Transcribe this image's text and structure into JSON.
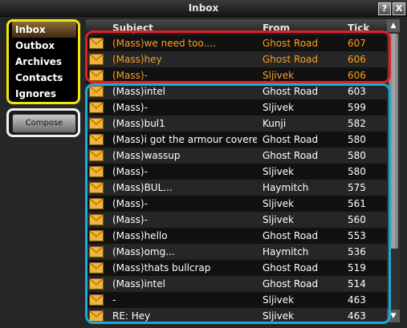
{
  "window": {
    "title": "Inbox",
    "help_label": "?",
    "close_label": "X"
  },
  "nav": {
    "items": [
      {
        "label": "Inbox",
        "selected": true
      },
      {
        "label": "Outbox",
        "selected": false
      },
      {
        "label": "Archives",
        "selected": false
      },
      {
        "label": "Contacts",
        "selected": false
      },
      {
        "label": "Ignores",
        "selected": false
      }
    ]
  },
  "compose": {
    "label": "Compose"
  },
  "table": {
    "columns": {
      "subject": "Subject",
      "from": "From",
      "tick": "Tick"
    },
    "rows": [
      {
        "subject": "(Mass)we need too....",
        "from": "Ghost Road",
        "tick": "607",
        "unread": true
      },
      {
        "subject": "(Mass)hey",
        "from": "Ghost Road",
        "tick": "606",
        "unread": true
      },
      {
        "subject": "(Mass)-",
        "from": "Sljivek",
        "tick": "606",
        "unread": true
      },
      {
        "subject": "(Mass)intel",
        "from": "Ghost Road",
        "tick": "603",
        "unread": false
      },
      {
        "subject": "(Mass)-",
        "from": "Sljivek",
        "tick": "599",
        "unread": false
      },
      {
        "subject": "(Mass)bul1",
        "from": "Kunji",
        "tick": "582",
        "unread": false
      },
      {
        "subject": "(Mass)i got the armour covered",
        "from": "Ghost Road",
        "tick": "580",
        "unread": false
      },
      {
        "subject": "(Mass)wassup",
        "from": "Ghost Road",
        "tick": "580",
        "unread": false
      },
      {
        "subject": "(Mass)-",
        "from": "Sljivek",
        "tick": "580",
        "unread": false
      },
      {
        "subject": "(Mass)BUL...",
        "from": "Haymitch",
        "tick": "575",
        "unread": false
      },
      {
        "subject": "(Mass)-",
        "from": "Sljivek",
        "tick": "561",
        "unread": false
      },
      {
        "subject": "(Mass)-",
        "from": "Sljivek",
        "tick": "560",
        "unread": false
      },
      {
        "subject": "(Mass)hello",
        "from": "Ghost Road",
        "tick": "553",
        "unread": false
      },
      {
        "subject": "(Mass)omg...",
        "from": "Haymitch",
        "tick": "536",
        "unread": false
      },
      {
        "subject": "(Mass)thats bullcrap",
        "from": "Ghost Road",
        "tick": "519",
        "unread": false
      },
      {
        "subject": "(Mass)intel",
        "from": "Ghost Road",
        "tick": "514",
        "unread": false
      },
      {
        "subject": "-",
        "from": "Sljivek",
        "tick": "463",
        "unread": false
      },
      {
        "subject": "RE: Hey",
        "from": "Sljivek",
        "tick": "463",
        "unread": false
      }
    ]
  },
  "colors": {
    "unread_text": "#ff9e1b",
    "read_text": "#ffffff",
    "nav_highlight": "#f2e60b",
    "compose_highlight": "#f0f0f0",
    "unread_highlight": "#e31d2a",
    "read_highlight": "#1aaae0"
  },
  "icons": {
    "mail": "envelope-icon",
    "scroll_up": "arrow-up-icon",
    "scroll_down": "arrow-down-icon"
  }
}
